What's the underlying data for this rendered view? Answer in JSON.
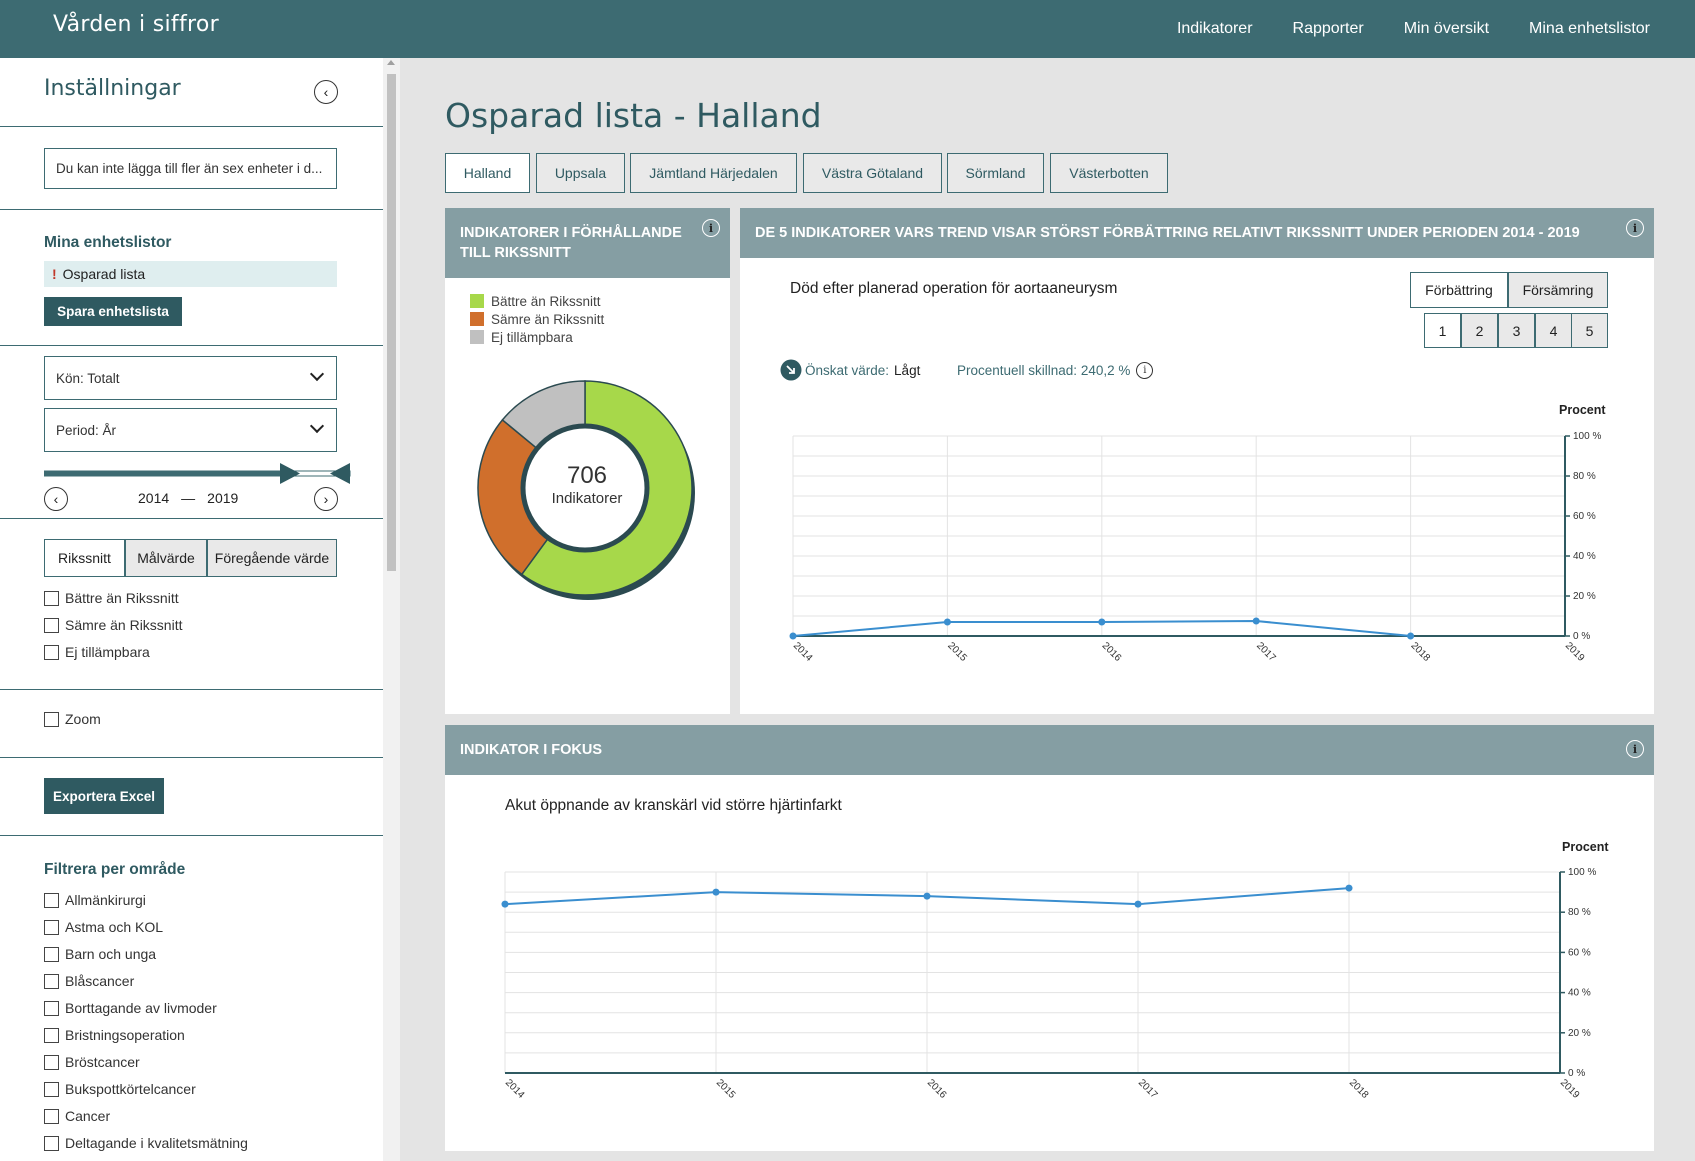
{
  "header": {
    "logo": "Vården i siffror",
    "nav": [
      "Indikatorer",
      "Rapporter",
      "Min översikt",
      "Mina enhetslistor"
    ]
  },
  "sidebar": {
    "title": "Inställningar",
    "unit_input_value": "Du kan inte lägga till fler än sex enheter i d...",
    "lists_heading": "Mina enhetslistor",
    "list_item": "Osparad lista",
    "list_item_marker": "!",
    "save_button": "Spara enhetslista",
    "gender_select": "Kön: Totalt",
    "period_select": "Period: År",
    "year_from": "2014",
    "year_sep": "—",
    "year_to": "2019",
    "compare_buttons": [
      "Rikssnitt",
      "Målvärde",
      "Föregående värde"
    ],
    "compare_checks": [
      "Bättre än Rikssnitt",
      "Sämre än Rikssnitt",
      "Ej tillämpbara"
    ],
    "zoom_label": "Zoom",
    "export_button": "Exportera Excel",
    "filter_heading": "Filtrera per område",
    "filter_items": [
      "Allmänkirurgi",
      "Astma och KOL",
      "Barn och unga",
      "Blåscancer",
      "Borttagande av livmoder",
      "Bristningsoperation",
      "Bröstcancer",
      "Bukspottkörtelcancer",
      "Cancer",
      "Deltagande i kvalitetsmätning"
    ]
  },
  "main": {
    "title": "Osparad lista - Halland",
    "tabs": [
      "Halland",
      "Uppsala",
      "Jämtland Härjedalen",
      "Västra Götaland",
      "Sörmland",
      "Västerbotten"
    ],
    "active_tab": 0
  },
  "panel_left": {
    "title_line1": "INDIKATORER I FÖRHÅLLANDE",
    "title_line2": "TILL RIKSSNITT",
    "legend": [
      "Bättre än Rikssnitt",
      "Sämre än Rikssnitt",
      "Ej tillämpbara"
    ],
    "total": "706",
    "total_label": "Indikatorer"
  },
  "panel_trend": {
    "title": "DE 5 INDIKATORER VARS TREND VISAR STÖRST FÖRBÄTTRING RELATIVT RIKSSNITT UNDER PERIODEN 2014 - 2019",
    "indicator": "Död efter planerad operation för aortaaneurysm",
    "toggle": [
      "Förbättring",
      "Försämring"
    ],
    "pages": [
      "1",
      "2",
      "3",
      "4",
      "5"
    ],
    "desired_label": "Önskat värde:",
    "desired_value": "Lågt",
    "diff_text": "Procentuell skillnad: 240,2 %",
    "unit": "Procent"
  },
  "panel_focus": {
    "title": "INDIKATOR I FOKUS",
    "indicator": "Akut öppnande av kranskärl vid större hjärtinfarkt",
    "unit": "Procent"
  },
  "colors": {
    "better": "#a7d84a",
    "worse": "#d06f2c",
    "na": "#c0c0c0",
    "line": "#3a8ecf",
    "brand": "#3d6b72"
  },
  "chart_data": [
    {
      "type": "pie",
      "categories": [
        "Bättre än Rikssnitt",
        "Sämre än Rikssnitt",
        "Ej tillämpbara"
      ],
      "values": [
        424,
        183,
        99
      ],
      "center_value": "706"
    },
    {
      "type": "line",
      "x": [
        "2014",
        "2015",
        "2016",
        "2017",
        "2018",
        "2019"
      ],
      "series": [
        {
          "values": [
            0,
            7,
            7,
            7.5,
            0,
            null
          ]
        }
      ],
      "ylabel": "Procent",
      "ylim": [
        0,
        100
      ],
      "yticks": [
        "0 %",
        "20 %",
        "40 %",
        "60 %",
        "80 %",
        "100 %"
      ],
      "grid": true
    },
    {
      "type": "line",
      "x": [
        "2014",
        "2015",
        "2016",
        "2017",
        "2018",
        "2019"
      ],
      "series": [
        {
          "values": [
            84,
            90,
            88,
            84,
            92,
            null
          ]
        }
      ],
      "ylabel": "Procent",
      "ylim": [
        0,
        100
      ],
      "yticks": [
        "0 %",
        "20 %",
        "40 %",
        "60 %",
        "80 %",
        "100 %"
      ],
      "grid": true
    }
  ]
}
